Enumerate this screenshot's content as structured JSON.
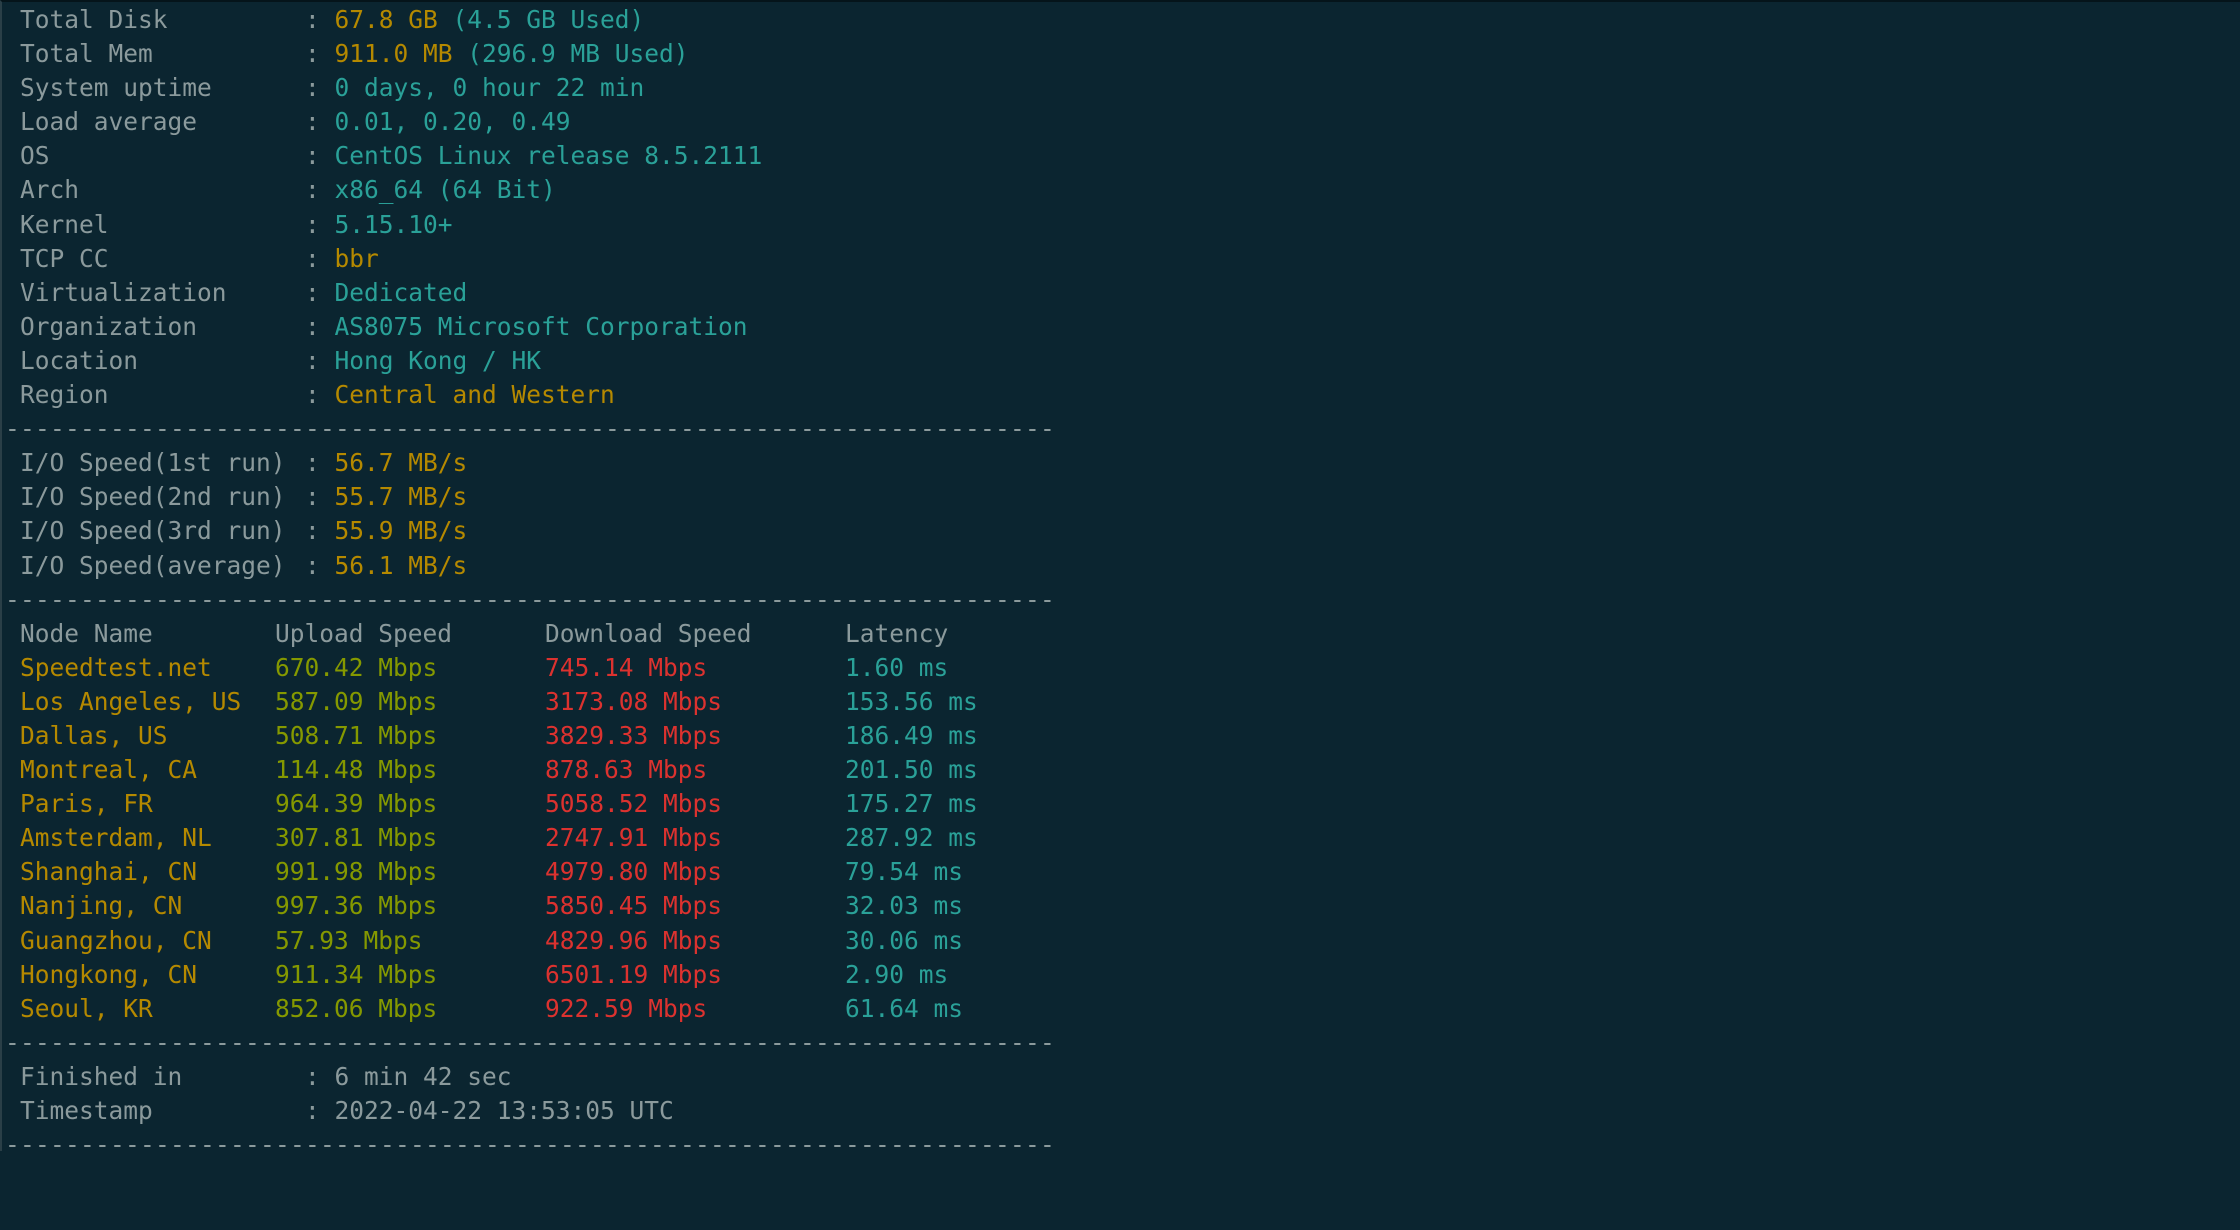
{
  "terminal": {
    "separator": "----------------------------------------------------------------------",
    "colors": {
      "background": "#0b2530",
      "label": "#8b9a9c",
      "yellow": "#b58900",
      "cyan": "#2aa198",
      "green": "#859900",
      "red": "#dc322f"
    }
  },
  "system_info": [
    {
      "label": "Total Disk",
      "value_highlight": "67.8 GB",
      "value_rest": " (4.5 GB Used)"
    },
    {
      "label": "Total Mem",
      "value_highlight": "911.0 MB",
      "value_rest": " (296.9 MB Used)"
    },
    {
      "label": "System uptime",
      "value": "0 days, 0 hour 22 min"
    },
    {
      "label": "Load average",
      "value": "0.01, 0.20, 0.49"
    },
    {
      "label": "OS",
      "value": "CentOS Linux release 8.5.2111"
    },
    {
      "label": "Arch",
      "value": "x86_64 (64 Bit)"
    },
    {
      "label": "Kernel",
      "value": "5.15.10+"
    },
    {
      "label": "TCP CC",
      "value": "bbr"
    },
    {
      "label": "Virtualization",
      "value": "Dedicated"
    },
    {
      "label": "Organization",
      "value": "AS8075 Microsoft Corporation"
    },
    {
      "label": "Location",
      "value": "Hong Kong / HK"
    },
    {
      "label": "Region",
      "value": "Central and Western"
    }
  ],
  "io_speed": [
    {
      "label": "I/O Speed(1st run)",
      "value": "56.7 MB/s"
    },
    {
      "label": "I/O Speed(2nd run)",
      "value": "55.7 MB/s"
    },
    {
      "label": "I/O Speed(3rd run)",
      "value": "55.9 MB/s"
    },
    {
      "label": "I/O Speed(average)",
      "value": "56.1 MB/s"
    }
  ],
  "speedtest": {
    "headers": [
      "Node Name",
      "Upload Speed",
      "Download Speed",
      "Latency"
    ],
    "rows": [
      {
        "node": "Speedtest.net",
        "upload": "670.42 Mbps",
        "download": "745.14 Mbps",
        "latency": "1.60 ms"
      },
      {
        "node": "Los Angeles, US",
        "upload": "587.09 Mbps",
        "download": "3173.08 Mbps",
        "latency": "153.56 ms"
      },
      {
        "node": "Dallas, US",
        "upload": "508.71 Mbps",
        "download": "3829.33 Mbps",
        "latency": "186.49 ms"
      },
      {
        "node": "Montreal, CA",
        "upload": "114.48 Mbps",
        "download": "878.63 Mbps",
        "latency": "201.50 ms"
      },
      {
        "node": "Paris, FR",
        "upload": "964.39 Mbps",
        "download": "5058.52 Mbps",
        "latency": "175.27 ms"
      },
      {
        "node": "Amsterdam, NL",
        "upload": "307.81 Mbps",
        "download": "2747.91 Mbps",
        "latency": "287.92 ms"
      },
      {
        "node": "Shanghai, CN",
        "upload": "991.98 Mbps",
        "download": "4979.80 Mbps",
        "latency": "79.54 ms"
      },
      {
        "node": "Nanjing, CN",
        "upload": "997.36 Mbps",
        "download": "5850.45 Mbps",
        "latency": "32.03 ms"
      },
      {
        "node": "Guangzhou, CN",
        "upload": "57.93 Mbps",
        "download": "4829.96 Mbps",
        "latency": "30.06 ms"
      },
      {
        "node": "Hongkong, CN",
        "upload": "911.34 Mbps",
        "download": "6501.19 Mbps",
        "latency": "2.90 ms"
      },
      {
        "node": "Seoul, KR",
        "upload": "852.06 Mbps",
        "download": "922.59 Mbps",
        "latency": "61.64 ms"
      }
    ]
  },
  "summary": [
    {
      "label": "Finished in",
      "value": "6 min 42 sec"
    },
    {
      "label": "Timestamp",
      "value": "2022-04-22 13:53:05 UTC"
    }
  ],
  "colon": ": "
}
